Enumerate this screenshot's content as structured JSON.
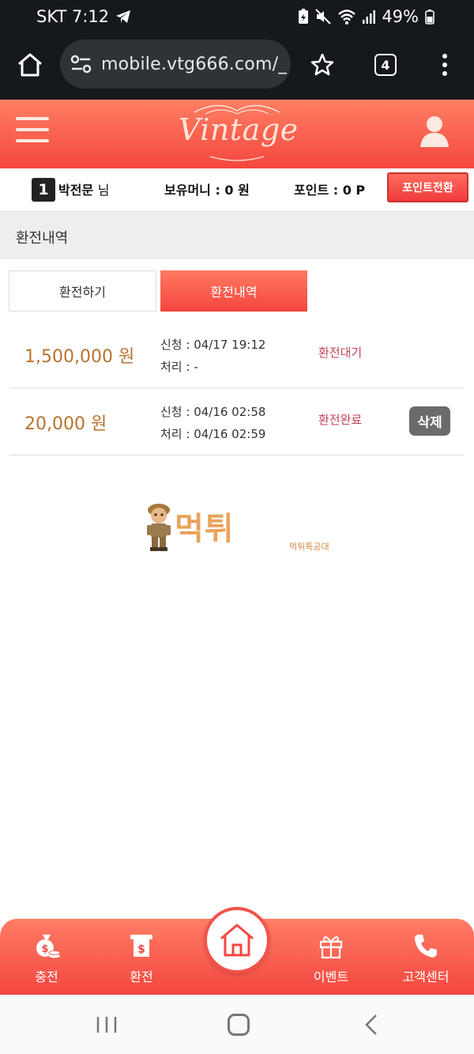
{
  "status_bar": {
    "carrier_time": "SKT 7:12",
    "battery": "49%"
  },
  "browser": {
    "url": "mobile.vtg666.com/_",
    "tab_count": "4"
  },
  "header": {
    "logo_text": "Vintage"
  },
  "user_bar": {
    "level": "1",
    "name": "박전문",
    "name_suffix": "님",
    "money": "보유머니 : 0 원",
    "points": "포인트 : 0 P",
    "convert_label": "포인트전환"
  },
  "section": {
    "title": "환전내역"
  },
  "tabs": [
    {
      "label": "환전하기",
      "active": false
    },
    {
      "label": "환전내역",
      "active": true
    }
  ],
  "history": [
    {
      "amount": "1,500,000 원",
      "requested": "신청 : 04/17 19:12",
      "processed": "처리 : -",
      "status": "환전대기",
      "delete_label": ""
    },
    {
      "amount": "20,000 원",
      "requested": "신청 : 04/16 02:58",
      "processed": "처리 : 04/16 02:59",
      "status": "환전완료",
      "delete_label": "삭제"
    }
  ],
  "watermark": {
    "text": "먹튀",
    "sub": "먹튀특공대"
  },
  "bottom_nav": [
    {
      "label": "충전",
      "icon": "money-bag-icon"
    },
    {
      "label": "환전",
      "icon": "exchange-icon"
    },
    {
      "label": "",
      "icon": "home-icon"
    },
    {
      "label": "이벤트",
      "icon": "gift-icon"
    },
    {
      "label": "고객센터",
      "icon": "phone-icon"
    }
  ],
  "colors": {
    "accent": "#f4473f",
    "amount": "#b9722e",
    "status": "#c2435a"
  }
}
